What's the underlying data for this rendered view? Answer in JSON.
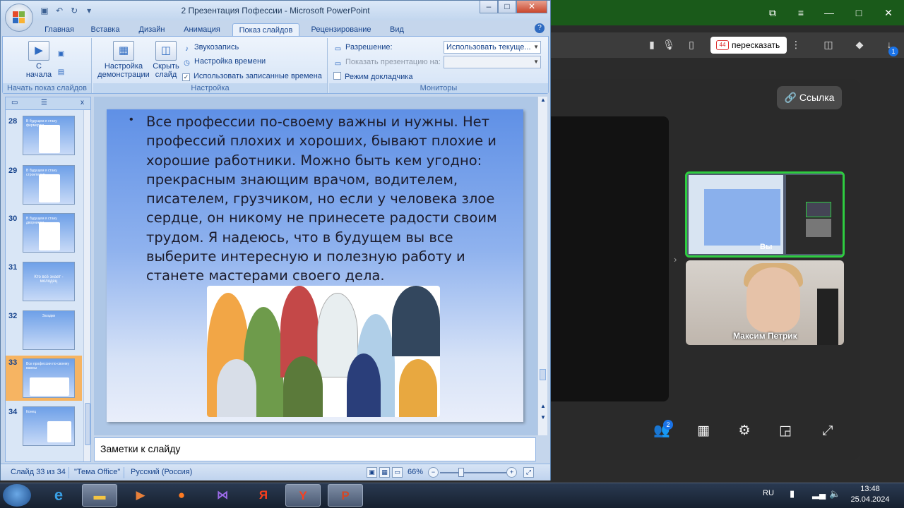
{
  "ppt": {
    "title": "2 Презентация Пофессии - Microsoft PowerPoint",
    "tabs": [
      "Главная",
      "Вставка",
      "Дизайн",
      "Анимация",
      "Показ слайдов",
      "Рецензирование",
      "Вид"
    ],
    "active_tab": "Показ слайдов",
    "ribbon": {
      "group1": {
        "label": "Начать показ слайдов",
        "from_start_line1": "С",
        "from_start_line2": "начала"
      },
      "group2": {
        "label": "Настройка",
        "setup_line1": "Настройка",
        "setup_line2": "демонстрации",
        "hide_line1": "Скрыть",
        "hide_line2": "слайд",
        "record_narration": "Звукозапись",
        "rehearse_timings": "Настройка времени",
        "use_timings": "Использовать записанные времена"
      },
      "group3": {
        "label": "Мониторы",
        "resolution_label": "Разрешение:",
        "resolution_value": "Использовать текуще...",
        "show_on_label": "Показать презентацию на:",
        "presenter_view": "Режим докладчика"
      }
    },
    "thumbnails": [
      {
        "num": "28",
        "title": "В будущем я стану фермером"
      },
      {
        "num": "29",
        "title": "В будущем я стану строителем"
      },
      {
        "num": "30",
        "title": "В будущем я стану дворником"
      },
      {
        "num": "31",
        "title": "Кто всё знает - молодец"
      },
      {
        "num": "32",
        "title": "Загадки"
      },
      {
        "num": "33",
        "title": "Все профессии по-своему важны"
      },
      {
        "num": "34",
        "title": "Конец"
      }
    ],
    "selected_slide": "33",
    "slide": {
      "bullet": "•",
      "text": "Все профессии по-своему важны  и нужны. Нет профессий плохих и хороших, бывают плохие и хорошие работники. Можно быть кем угодно: прекрасным знающим врачом, водителем, писателем, грузчиком, но если у человека злое сердце, он никому не принесете радости своим трудом. Я надеюсь, что в будущем вы все выберите интересную и полезную работу и станете мастерами своего дела."
    },
    "notes_placeholder": "Заметки к слайду",
    "status": {
      "slide_counter": "Слайд 33 из 34",
      "theme": "\"Тема Office\"",
      "language": "Русский (Россия)",
      "zoom": "66%"
    }
  },
  "browser": {
    "retell_label": "пересказать",
    "retell_badge": "44",
    "ext_badge": "1",
    "link_button": "Ссылка",
    "self_label": "Вы",
    "participant_name": "Максим Петрик",
    "people_count": "2"
  },
  "taskbar": {
    "language": "RU",
    "time": "13:48",
    "date": "25.04.2024"
  },
  "colors": {
    "ppt_chrome": "#c5d6ec",
    "slide_gradient_top": "#5f90e6",
    "selected_thumb": "#f6b462",
    "self_tile_border": "#2ecc40",
    "browser_titlebar": "#1a5a1a"
  }
}
